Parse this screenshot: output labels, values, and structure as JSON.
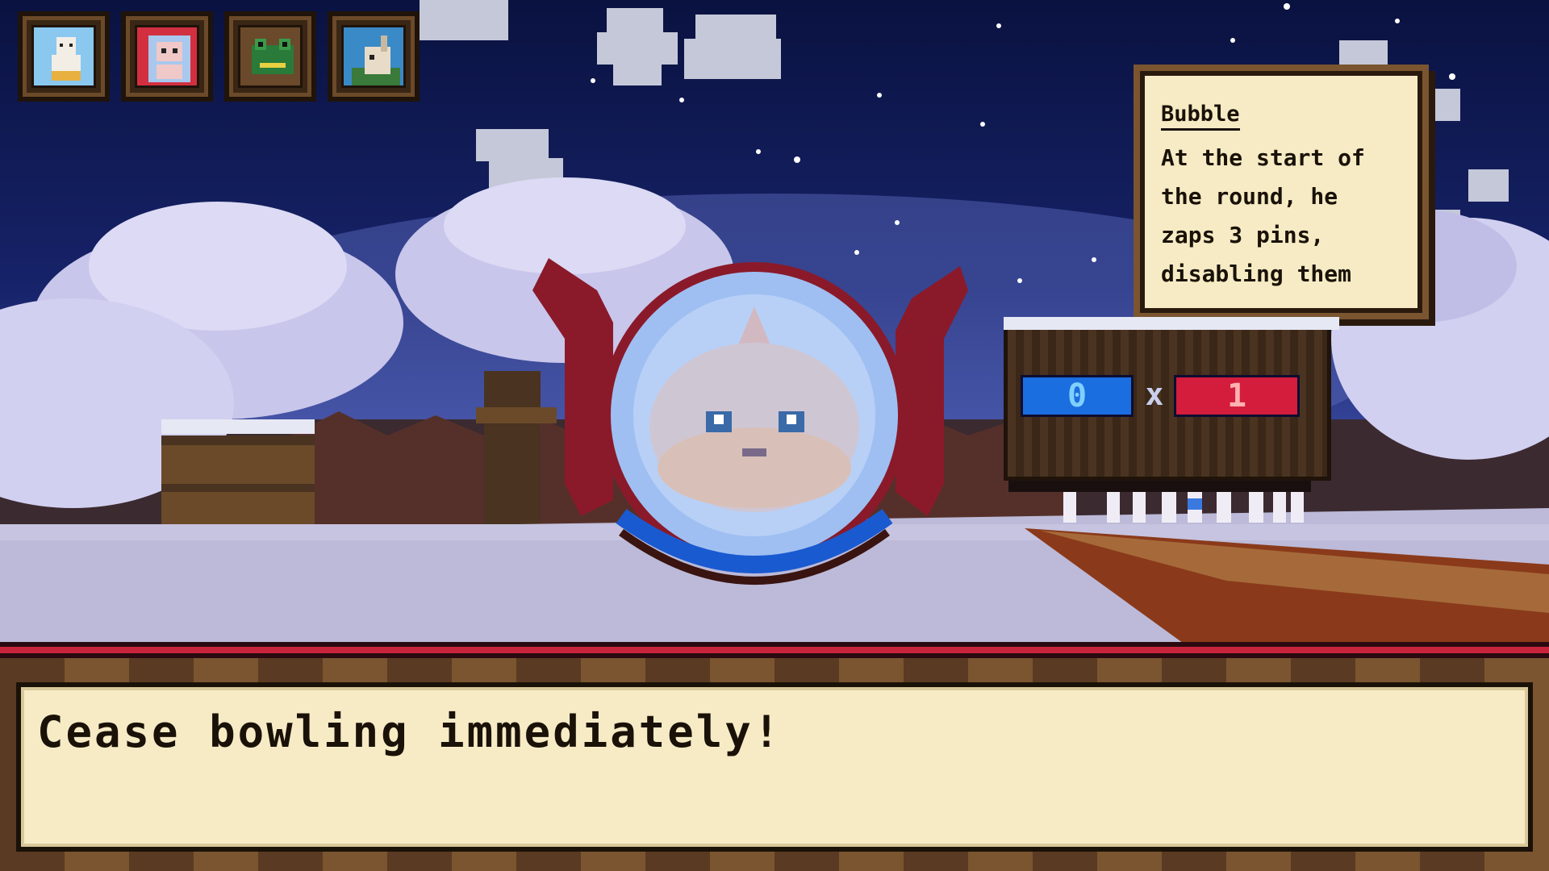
{
  "portraits": [
    {
      "name": "ghost-character"
    },
    {
      "name": "robot-character"
    },
    {
      "name": "frog-character"
    },
    {
      "name": "goat-character"
    }
  ],
  "tooltip": {
    "name": "Bubble",
    "description_lines": [
      "At the start of",
      "the round, he",
      "zaps 3 pins,",
      "disabling them"
    ]
  },
  "scoreboard": {
    "blue_score": "0",
    "separator": "x",
    "red_score": "1"
  },
  "dialog": {
    "text": "Cease bowling immediately!"
  },
  "colors": {
    "blue_team": "#1b6ee0",
    "red_team": "#d41c3c",
    "dialog_bg": "#f7ebc6"
  }
}
